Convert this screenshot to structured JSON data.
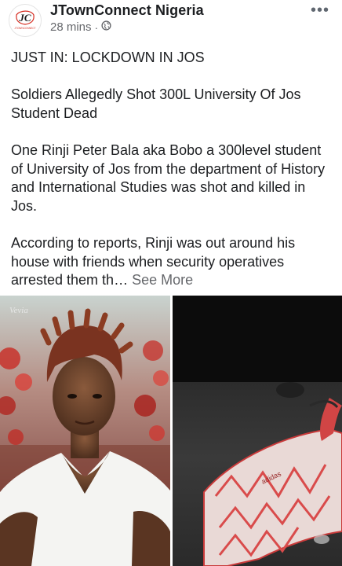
{
  "post": {
    "page_name": "JTownConnect Nigeria",
    "timestamp": "28 mins",
    "separator": "·",
    "privacy_icon": "globe-icon",
    "more_label": "•••",
    "avatar_text": "JC",
    "avatar_subtext": "JTOWNCONNECT",
    "paragraphs": [
      "JUST IN: LOCKDOWN IN JOS",
      "Soldiers Allegedly Shot 300L University Of Jos Student Dead",
      "One Rinji Peter Bala aka Bobo a 300level student of University of Jos from the department of History and International Studies was shot and killed in Jos."
    ],
    "last_paragraph": "According to reports, Rinji was out around his house with friends when security operatives arrested them th…",
    "see_more": "See More",
    "photo_left_logo": "Vevia",
    "photo_right_text": "adidas",
    "colors": {
      "name": "#1c1e21",
      "meta": "#65676b",
      "brand_red": "#d62b1f"
    }
  }
}
